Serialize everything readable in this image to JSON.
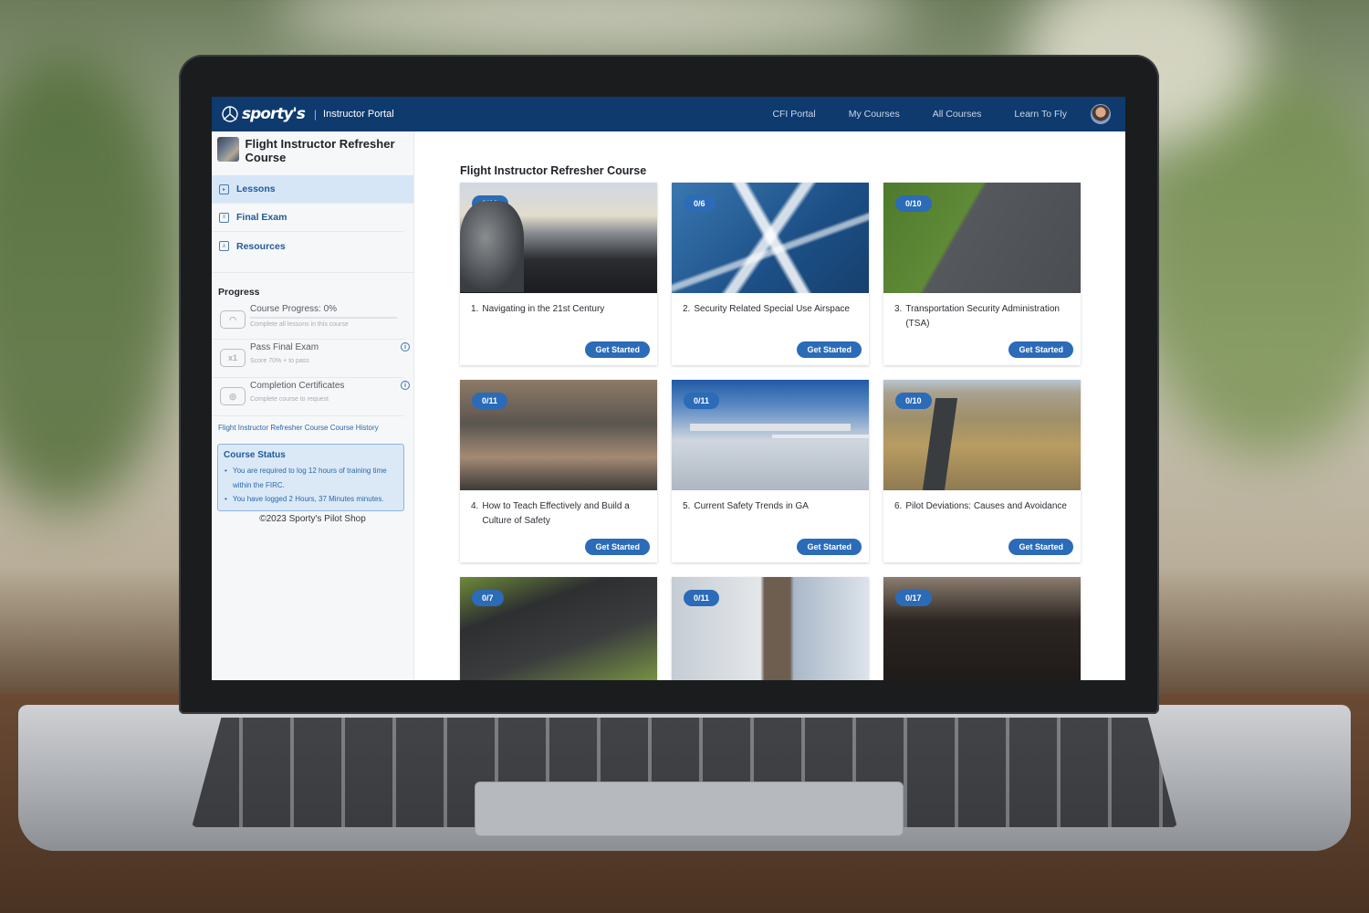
{
  "header": {
    "brand": "sporty's",
    "portal_label": "Instructor Portal",
    "nav": [
      {
        "label": "CFI Portal"
      },
      {
        "label": "My Courses"
      },
      {
        "label": "All Courses"
      },
      {
        "label": "Learn To Fly"
      }
    ]
  },
  "sidebar": {
    "course_title": "Flight Instructor Refresher Course",
    "menu": [
      {
        "label": "Lessons",
        "icon": "video-icon",
        "active": true
      },
      {
        "label": "Final Exam",
        "icon": "document-icon",
        "active": false
      },
      {
        "label": "Resources",
        "icon": "pdf-icon",
        "active": false
      }
    ],
    "progress": {
      "title": "Progress",
      "items": [
        {
          "label": "Course Progress: 0%",
          "sub": "Complete all lessons in this course",
          "icon": "gauge-icon",
          "percent": 0
        },
        {
          "label": "Pass Final Exam",
          "sub": "Score 70% + to pass",
          "icon": "exam-icon",
          "icon_text": "x1"
        },
        {
          "label": "Completion Certificates",
          "sub": "Complete course to request",
          "icon": "certificate-icon"
        }
      ]
    },
    "history_link": "Flight Instructor Refresher Course Course History",
    "status": {
      "title": "Course Status",
      "items": [
        "You are required to log 12 hours of training time within the FIRC.",
        "You have logged 2 Hours, 37 Minutes minutes."
      ]
    },
    "copyright": "©2023 Sporty's Pilot Shop"
  },
  "main": {
    "title": "Flight Instructor Refresher Course",
    "button_label": "Get Started",
    "lessons": [
      {
        "num": "1.",
        "title": "Navigating in the 21st Century",
        "progress": "0/10"
      },
      {
        "num": "2.",
        "title": "Security Related Special Use Airspace",
        "progress": "0/6"
      },
      {
        "num": "3.",
        "title": "Transportation Security Administration (TSA)",
        "progress": "0/10"
      },
      {
        "num": "4.",
        "title": "How to Teach Effectively and Build a Culture of Safety",
        "progress": "0/11"
      },
      {
        "num": "5.",
        "title": "Current Safety Trends in GA",
        "progress": "0/11"
      },
      {
        "num": "6.",
        "title": "Pilot Deviations: Causes and Avoidance",
        "progress": "0/10"
      },
      {
        "num": "",
        "title": "",
        "progress": "0/7"
      },
      {
        "num": "",
        "title": "",
        "progress": "0/11"
      },
      {
        "num": "",
        "title": "",
        "progress": "0/17"
      }
    ]
  },
  "colors": {
    "header_bg": "#0e3a6e",
    "accent": "#2b6bb8",
    "active_menu_bg": "#d6e6f7"
  }
}
